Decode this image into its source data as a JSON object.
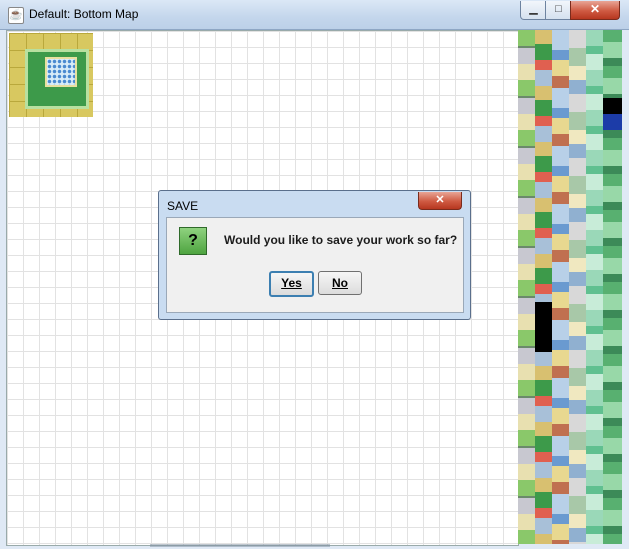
{
  "window": {
    "title": "Default: Bottom Map",
    "icon": "java-cup-icon",
    "controls": {
      "minimize": "minimize-icon",
      "maximize": "maximize-icon",
      "close": "close-icon"
    }
  },
  "dialog": {
    "title": "SAVE",
    "icon": "question-icon",
    "icon_glyph": "?",
    "message": "Would you like to save your work so far?",
    "buttons": {
      "yes": "Yes",
      "no": "No"
    }
  },
  "colors": {
    "titlebar": "#c4d6ec",
    "close_button": "#cf5a42",
    "dialog_frame": "#c9dcf1",
    "question_icon": "#4ea440"
  }
}
